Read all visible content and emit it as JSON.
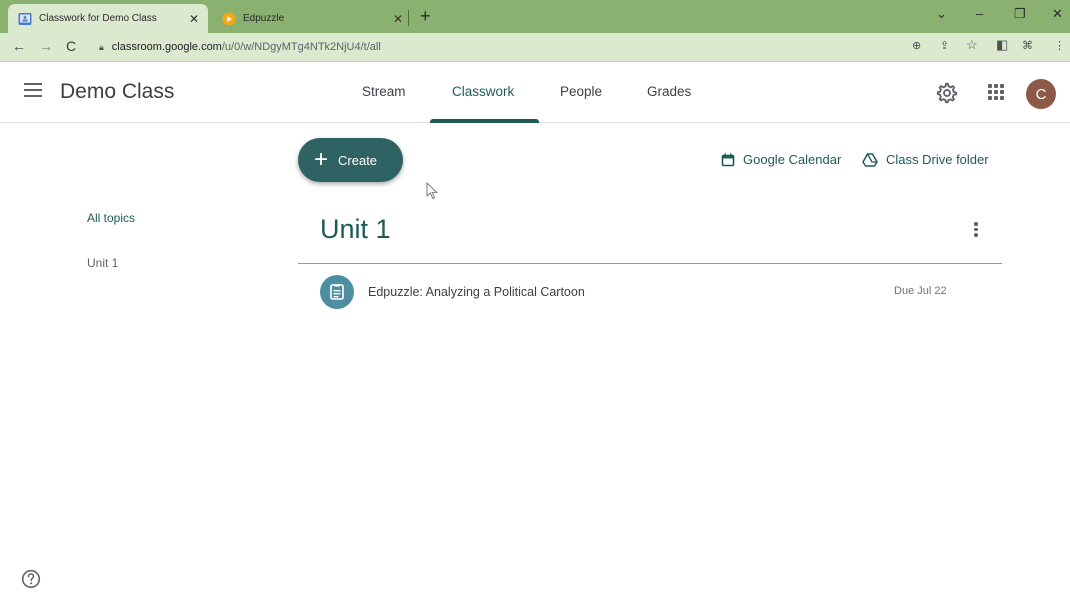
{
  "browser": {
    "tabs": [
      {
        "title": "Classwork for Demo Class",
        "active": true
      },
      {
        "title": "Edpuzzle",
        "active": false
      }
    ],
    "url_host": "classroom.google.com",
    "url_path": "/u/0/w/NDgyMTg4NTk2NjU4/t/all"
  },
  "header": {
    "class_name": "Demo Class",
    "tabs": [
      "Stream",
      "Classwork",
      "People",
      "Grades"
    ],
    "selected_tab": "Classwork",
    "avatar_initial": "C"
  },
  "toolbar": {
    "create_label": "Create",
    "calendar_label": "Google Calendar",
    "drive_label": "Class Drive folder"
  },
  "topics": {
    "items": [
      "All topics",
      "Unit 1"
    ]
  },
  "unit": {
    "title": "Unit 1",
    "assignments": [
      {
        "title": "Edpuzzle: Analyzing a Political Cartoon",
        "due": "Due Jul 22"
      }
    ]
  },
  "colors": {
    "accent": "#1e5b56",
    "create_button": "#2f6363",
    "browser_frame": "#8ab16f",
    "assignment_icon": "#4d8fa0",
    "avatar": "#8d5a4a"
  }
}
